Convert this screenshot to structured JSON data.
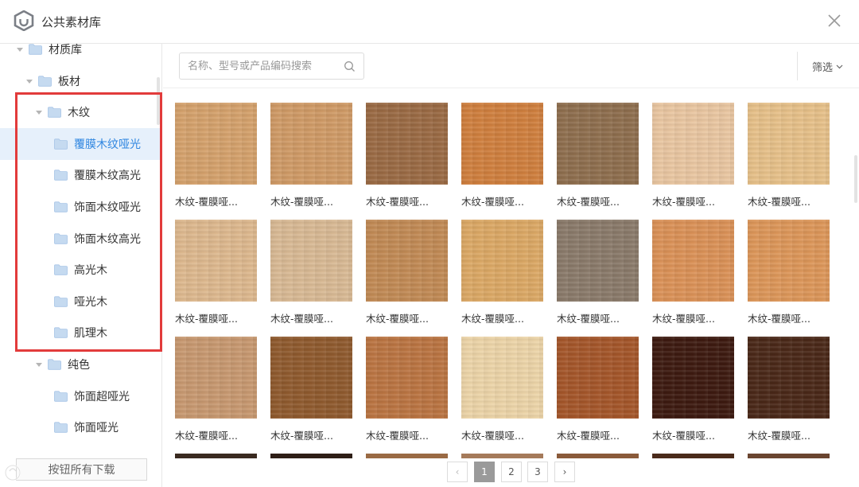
{
  "window": {
    "title": "公共素材库",
    "logo_icon": "hexagon-logo-icon",
    "close_icon": "close-icon"
  },
  "sidebar": {
    "items": [
      {
        "label": "材质库",
        "level": 0,
        "expanded": true
      },
      {
        "label": "板材",
        "level": 1,
        "expanded": true
      },
      {
        "label": "木纹",
        "level": 2,
        "expanded": true
      },
      {
        "label": "覆膜木纹哑光",
        "level": 3,
        "selected": true
      },
      {
        "label": "覆膜木纹高光",
        "level": 3
      },
      {
        "label": "饰面木纹哑光",
        "level": 3
      },
      {
        "label": "饰面木纹高光",
        "level": 3
      },
      {
        "label": "高光木",
        "level": 3
      },
      {
        "label": "哑光木",
        "level": 3
      },
      {
        "label": "肌理木",
        "level": 3
      },
      {
        "label": "纯色",
        "level": 2,
        "expanded": true
      },
      {
        "label": "饰面超哑光",
        "level": 3
      },
      {
        "label": "饰面哑光",
        "level": 3
      }
    ],
    "bottom_button": "按钮所有下载",
    "highlight_color": "#e23b3b",
    "selected_color": "#2f86e0"
  },
  "toolbar": {
    "search_placeholder": "名称、型号或产品编码搜索",
    "search_value": "",
    "filter_label": "筛选"
  },
  "materials": {
    "label": "木纹-覆膜哑...",
    "rows": [
      [
        "#d4a16c",
        "#cf9a66",
        "#9a6a44",
        "#cf7f3e",
        "#8e6e4e",
        "#e9c6a1",
        "#e6c089"
      ],
      [
        "#ddb88e",
        "#d8b994",
        "#c18a55",
        "#dba865",
        "#8a7a6a",
        "#da9157",
        "#dc9659"
      ],
      [
        "#c79870",
        "#8f5a2e",
        "#ba7442",
        "#ecd4a8",
        "#a4562a",
        "#3d1a10",
        "#4a2818"
      ]
    ],
    "peek_row": [
      "#3a2a20",
      "#2e1e16",
      "#9a6a44",
      "#a57a5a",
      "#8a5a3a",
      "#4a2a1a",
      "#6a4530"
    ]
  },
  "pagination": {
    "prev": "‹",
    "pages": [
      "1",
      "2",
      "3"
    ],
    "current": "1",
    "next": "›"
  }
}
